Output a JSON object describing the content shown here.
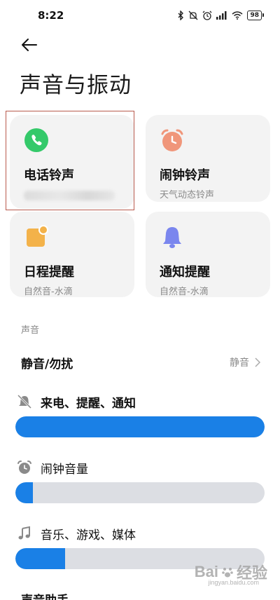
{
  "status_bar": {
    "time": "8:22",
    "battery": "98",
    "icons": [
      "bluetooth-icon",
      "mute-vibrate-icon",
      "alarm-icon",
      "signal-icon",
      "wifi-icon",
      "battery-icon"
    ]
  },
  "header": {
    "back_icon": "arrow-left-icon",
    "title": "声音与振动"
  },
  "cards": [
    {
      "title": "电话铃声",
      "subtitle": "",
      "icon": "phone-icon",
      "icon_color": "#34c96a",
      "highlighted": true
    },
    {
      "title": "闹钟铃声",
      "subtitle": "天气动态铃声",
      "icon": "alarm-clock-icon",
      "icon_color": "#f0967a"
    },
    {
      "title": "日程提醒",
      "subtitle": "自然音-水滴",
      "icon": "calendar-icon",
      "icon_color": "#f3b24a"
    },
    {
      "title": "通知提醒",
      "subtitle": "自然音-水滴",
      "icon": "bell-icon",
      "icon_color": "#7a86ee"
    }
  ],
  "section": {
    "label": "声音",
    "mute_row": {
      "label": "静音/勿扰",
      "value": "静音"
    },
    "volumes": [
      {
        "label": "来电、提醒、通知",
        "icon": "bell-muted-icon",
        "level": 1.0
      },
      {
        "label": "闹钟音量",
        "icon": "alarm-small-icon",
        "level": 0.07
      },
      {
        "label": "音乐、游戏、媒体",
        "icon": "music-note-icon",
        "level": 0.2
      }
    ],
    "next_row_label": "声音助手"
  },
  "watermark": {
    "brand": "Bai",
    "brand_suffix": "经验",
    "url": "jingyan.baidu.com"
  },
  "colors": {
    "accent": "#1a80e6",
    "card_bg": "#f3f3f3",
    "track": "#dcdee3"
  }
}
